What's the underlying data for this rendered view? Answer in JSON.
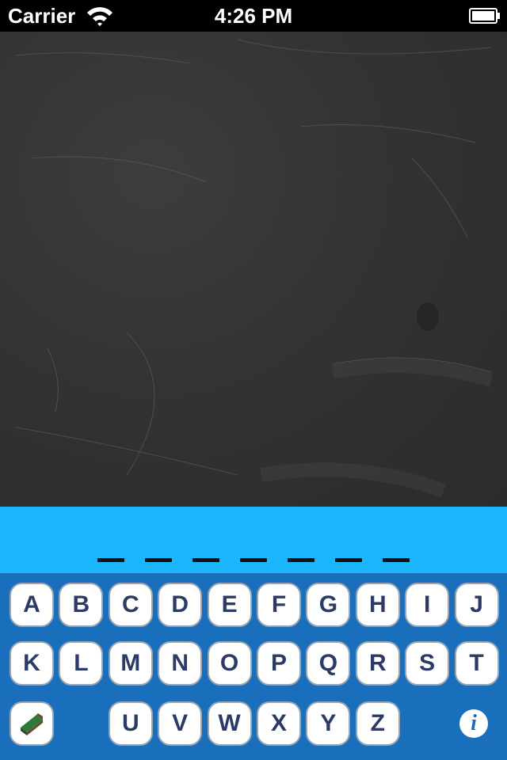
{
  "status_bar": {
    "carrier": "Carrier",
    "time": "4:26 PM"
  },
  "word": {
    "slot_count": 7
  },
  "keyboard": {
    "rows": [
      [
        "A",
        "B",
        "C",
        "D",
        "E",
        "F",
        "G",
        "H",
        "I",
        "J"
      ],
      [
        "K",
        "L",
        "M",
        "N",
        "O",
        "P",
        "Q",
        "R",
        "S",
        "T"
      ],
      [
        "U",
        "V",
        "W",
        "X",
        "Y",
        "Z"
      ]
    ],
    "info_label": "i"
  },
  "colors": {
    "word_bar": "#1bb6fb",
    "keyboard_bg": "#1a6fbd",
    "key_text": "#2b3a66"
  }
}
